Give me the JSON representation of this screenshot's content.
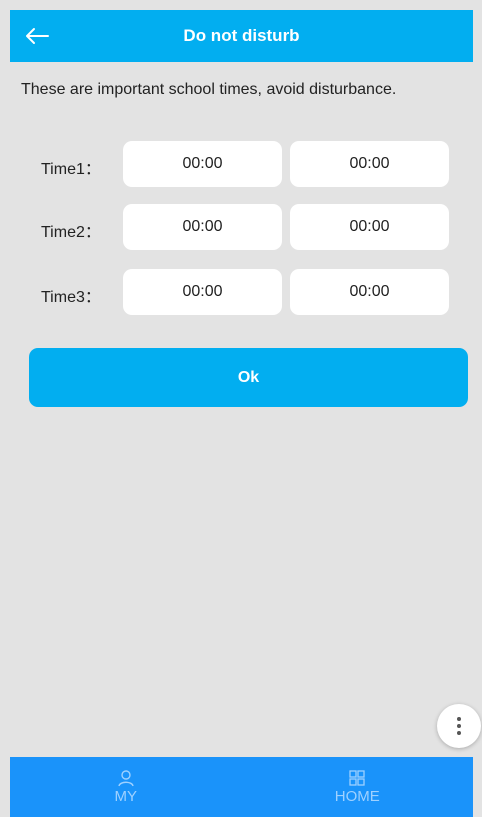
{
  "header": {
    "title": "Do not disturb",
    "back_icon": "arrow-left-icon"
  },
  "description": "These are important school times, avoid disturbance.",
  "time_slots": [
    {
      "label": "Time1：",
      "start": "00:00",
      "end": "00:00"
    },
    {
      "label": "Time2：",
      "start": "00:00",
      "end": "00:00"
    },
    {
      "label": "Time3：",
      "start": "00:00",
      "end": "00:00"
    }
  ],
  "ok_button": {
    "label": "Ok"
  },
  "more_button": {
    "icon": "more-vertical-icon"
  },
  "bottom_nav": {
    "items": [
      {
        "label": "MY",
        "icon": "person-icon"
      },
      {
        "label": "HOME",
        "icon": "grid-icon"
      }
    ]
  },
  "colors": {
    "primary": "#02aef0",
    "nav_background": "#1a93fa",
    "nav_text": "#9fd1ff",
    "page_background": "#e3e3e3",
    "field_background": "#ffffff"
  }
}
